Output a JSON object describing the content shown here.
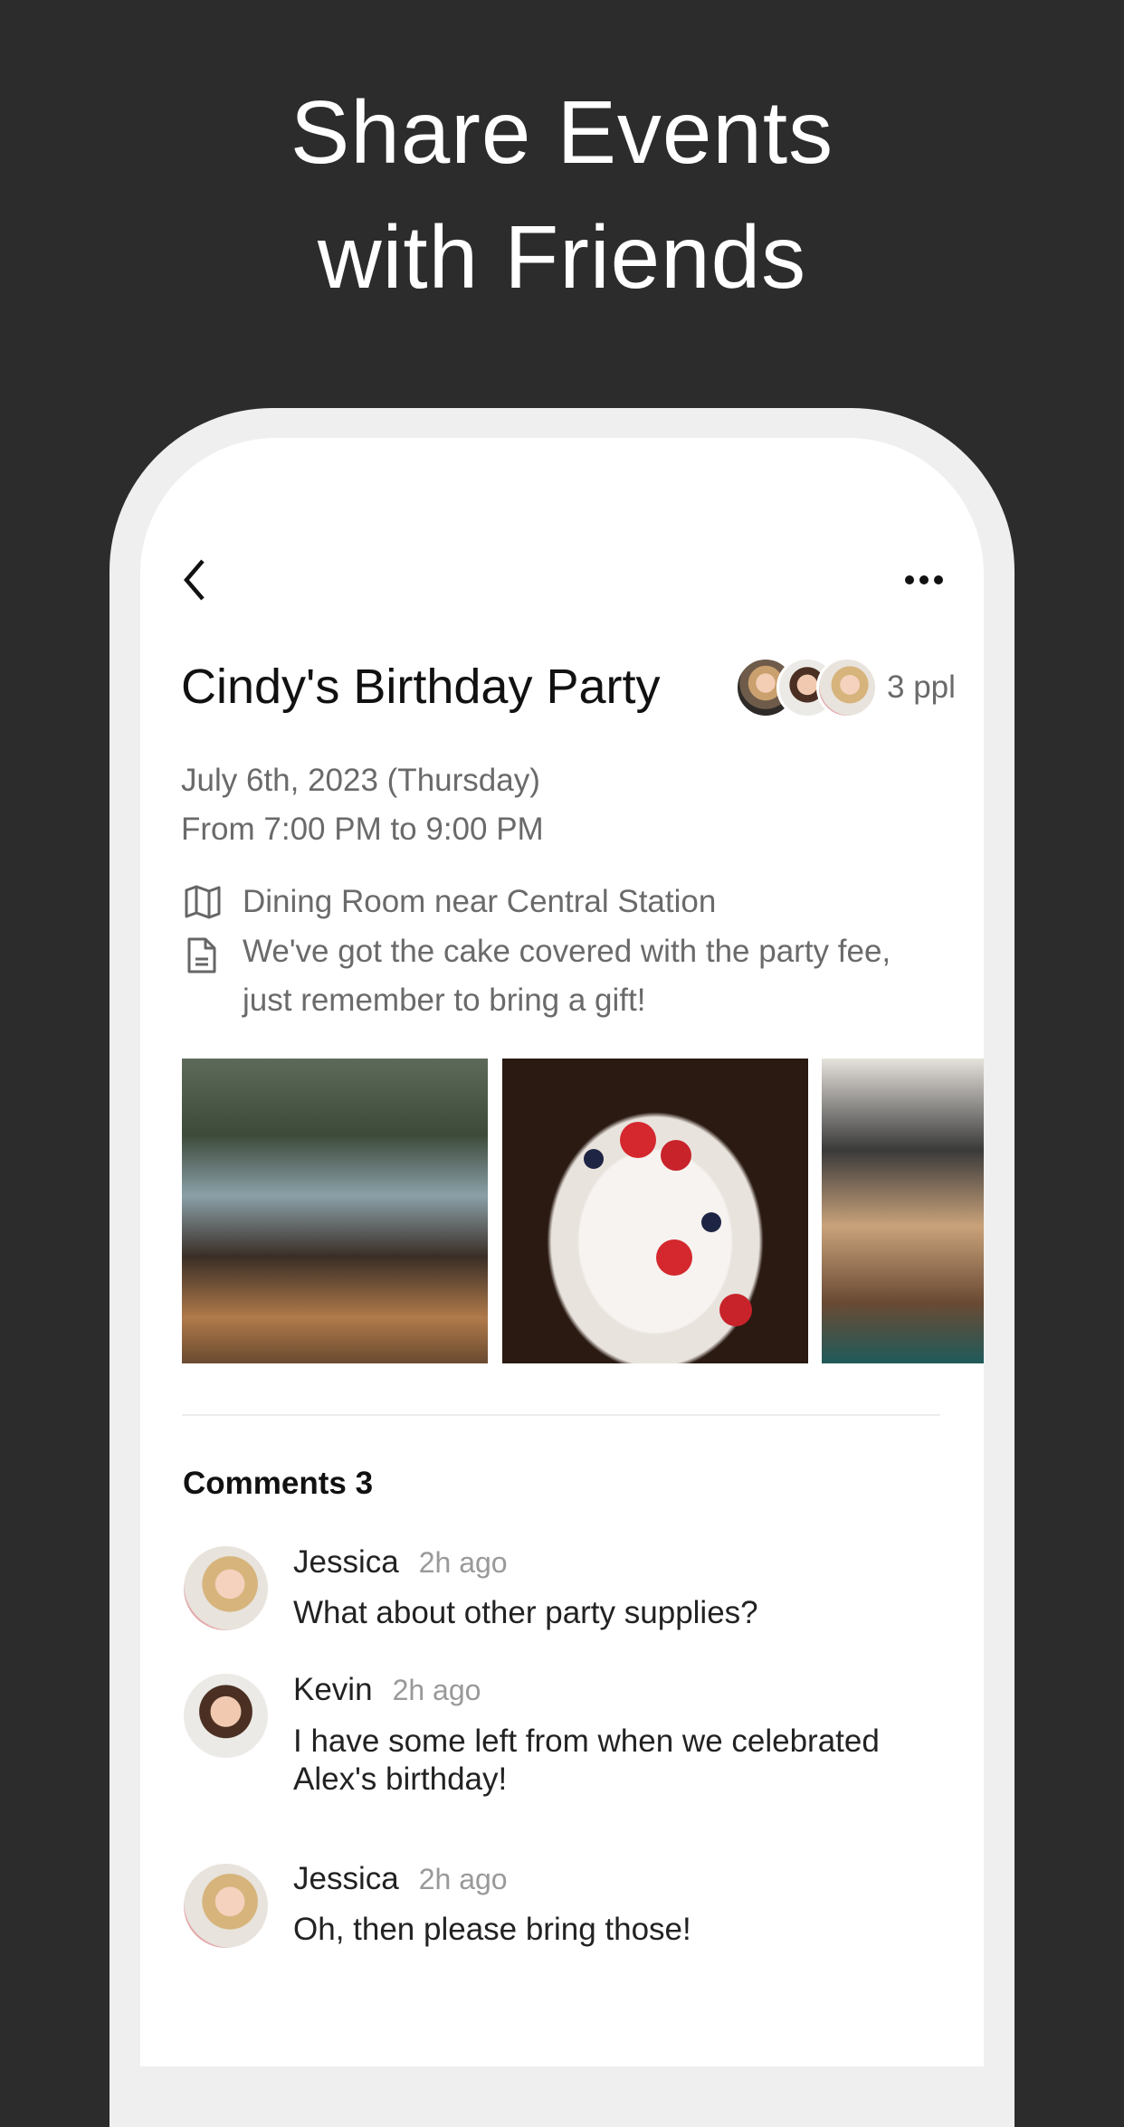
{
  "headline": {
    "line1": "Share Events",
    "line2": "with Friends"
  },
  "header": {
    "back_icon": "chevron-left-icon",
    "more_icon": "ellipsis-icon"
  },
  "event": {
    "title": "Cindy's Birthday Party",
    "attendees_count": "3 ppl",
    "date": "July 6th, 2023 (Thursday)",
    "time": "From 7:00 PM to 9:00 PM",
    "location_icon": "map-icon",
    "location": "Dining Room near Central Station",
    "note_icon": "document-icon",
    "note_line1": "We've got the cake covered with the party fee,",
    "note_line2": "just remember to bring a gift!"
  },
  "comments": {
    "title": "Comments 3",
    "items": [
      {
        "name": "Jessica",
        "time": "2h ago",
        "text": "What about other party supplies?"
      },
      {
        "name": "Kevin",
        "time": "2h ago",
        "text": "I have some left from when we celebrated Alex's birthday!"
      },
      {
        "name": "Jessica",
        "time": "2h ago",
        "text": "Oh, then please bring those!"
      }
    ]
  }
}
